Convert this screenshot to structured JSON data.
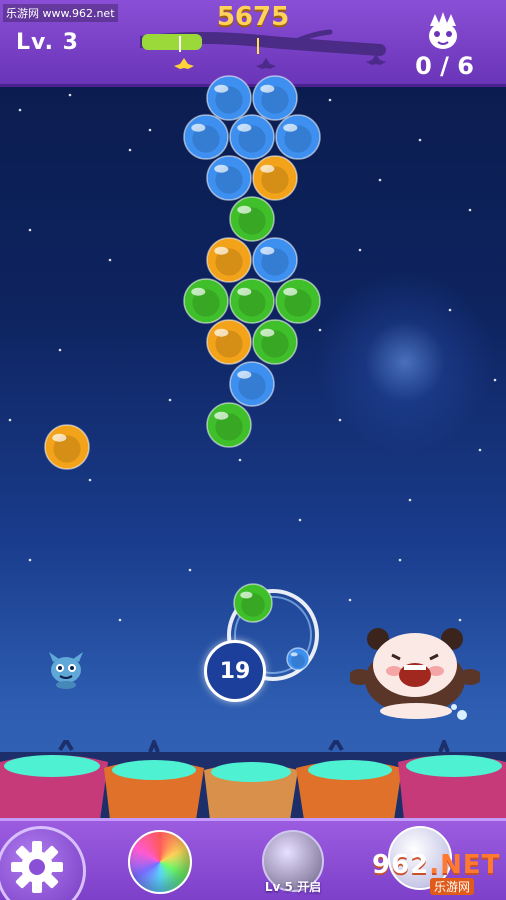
{
  "watermark": "乐游网 www.962.net",
  "hud": {
    "level_text": "Lv.  3",
    "score": "5675",
    "monster_counter": "0 / 6",
    "score_progress": 0.28
  },
  "shooter": {
    "moves_left": "19"
  },
  "boosters": {
    "locked_label": "Lv 5 开启"
  },
  "logo": {
    "main_a": "962",
    "main_b": ".NET",
    "sub": "乐游网"
  },
  "colors": {
    "blue": "#3d8ff0",
    "green": "#3fbf2a",
    "orange": "#f3a31a",
    "top_bar": "#7a42c8",
    "score_gold": "#ffd25a"
  },
  "bubbles": [
    {
      "color": "blue"
    },
    {
      "color": "blue"
    },
    {
      "color": "blue"
    },
    {
      "color": "blue"
    },
    {
      "color": "blue"
    },
    {
      "color": "blue"
    },
    {
      "color": "orange"
    },
    {
      "color": "green"
    },
    {
      "color": "orange"
    },
    {
      "color": "blue"
    },
    {
      "color": "green"
    },
    {
      "color": "green"
    },
    {
      "color": "green"
    },
    {
      "color": "orange"
    },
    {
      "color": "green"
    },
    {
      "color": "blue"
    },
    {
      "color": "green"
    },
    {
      "color": "orange"
    }
  ],
  "current_bubble": "green",
  "next_bubble": "blue",
  "icons": {
    "settings": "gear-icon",
    "booster_1": "rainbow-bubble-icon",
    "booster_2": "locked-bubble-icon",
    "booster_3": "silver-bubble-icon"
  }
}
